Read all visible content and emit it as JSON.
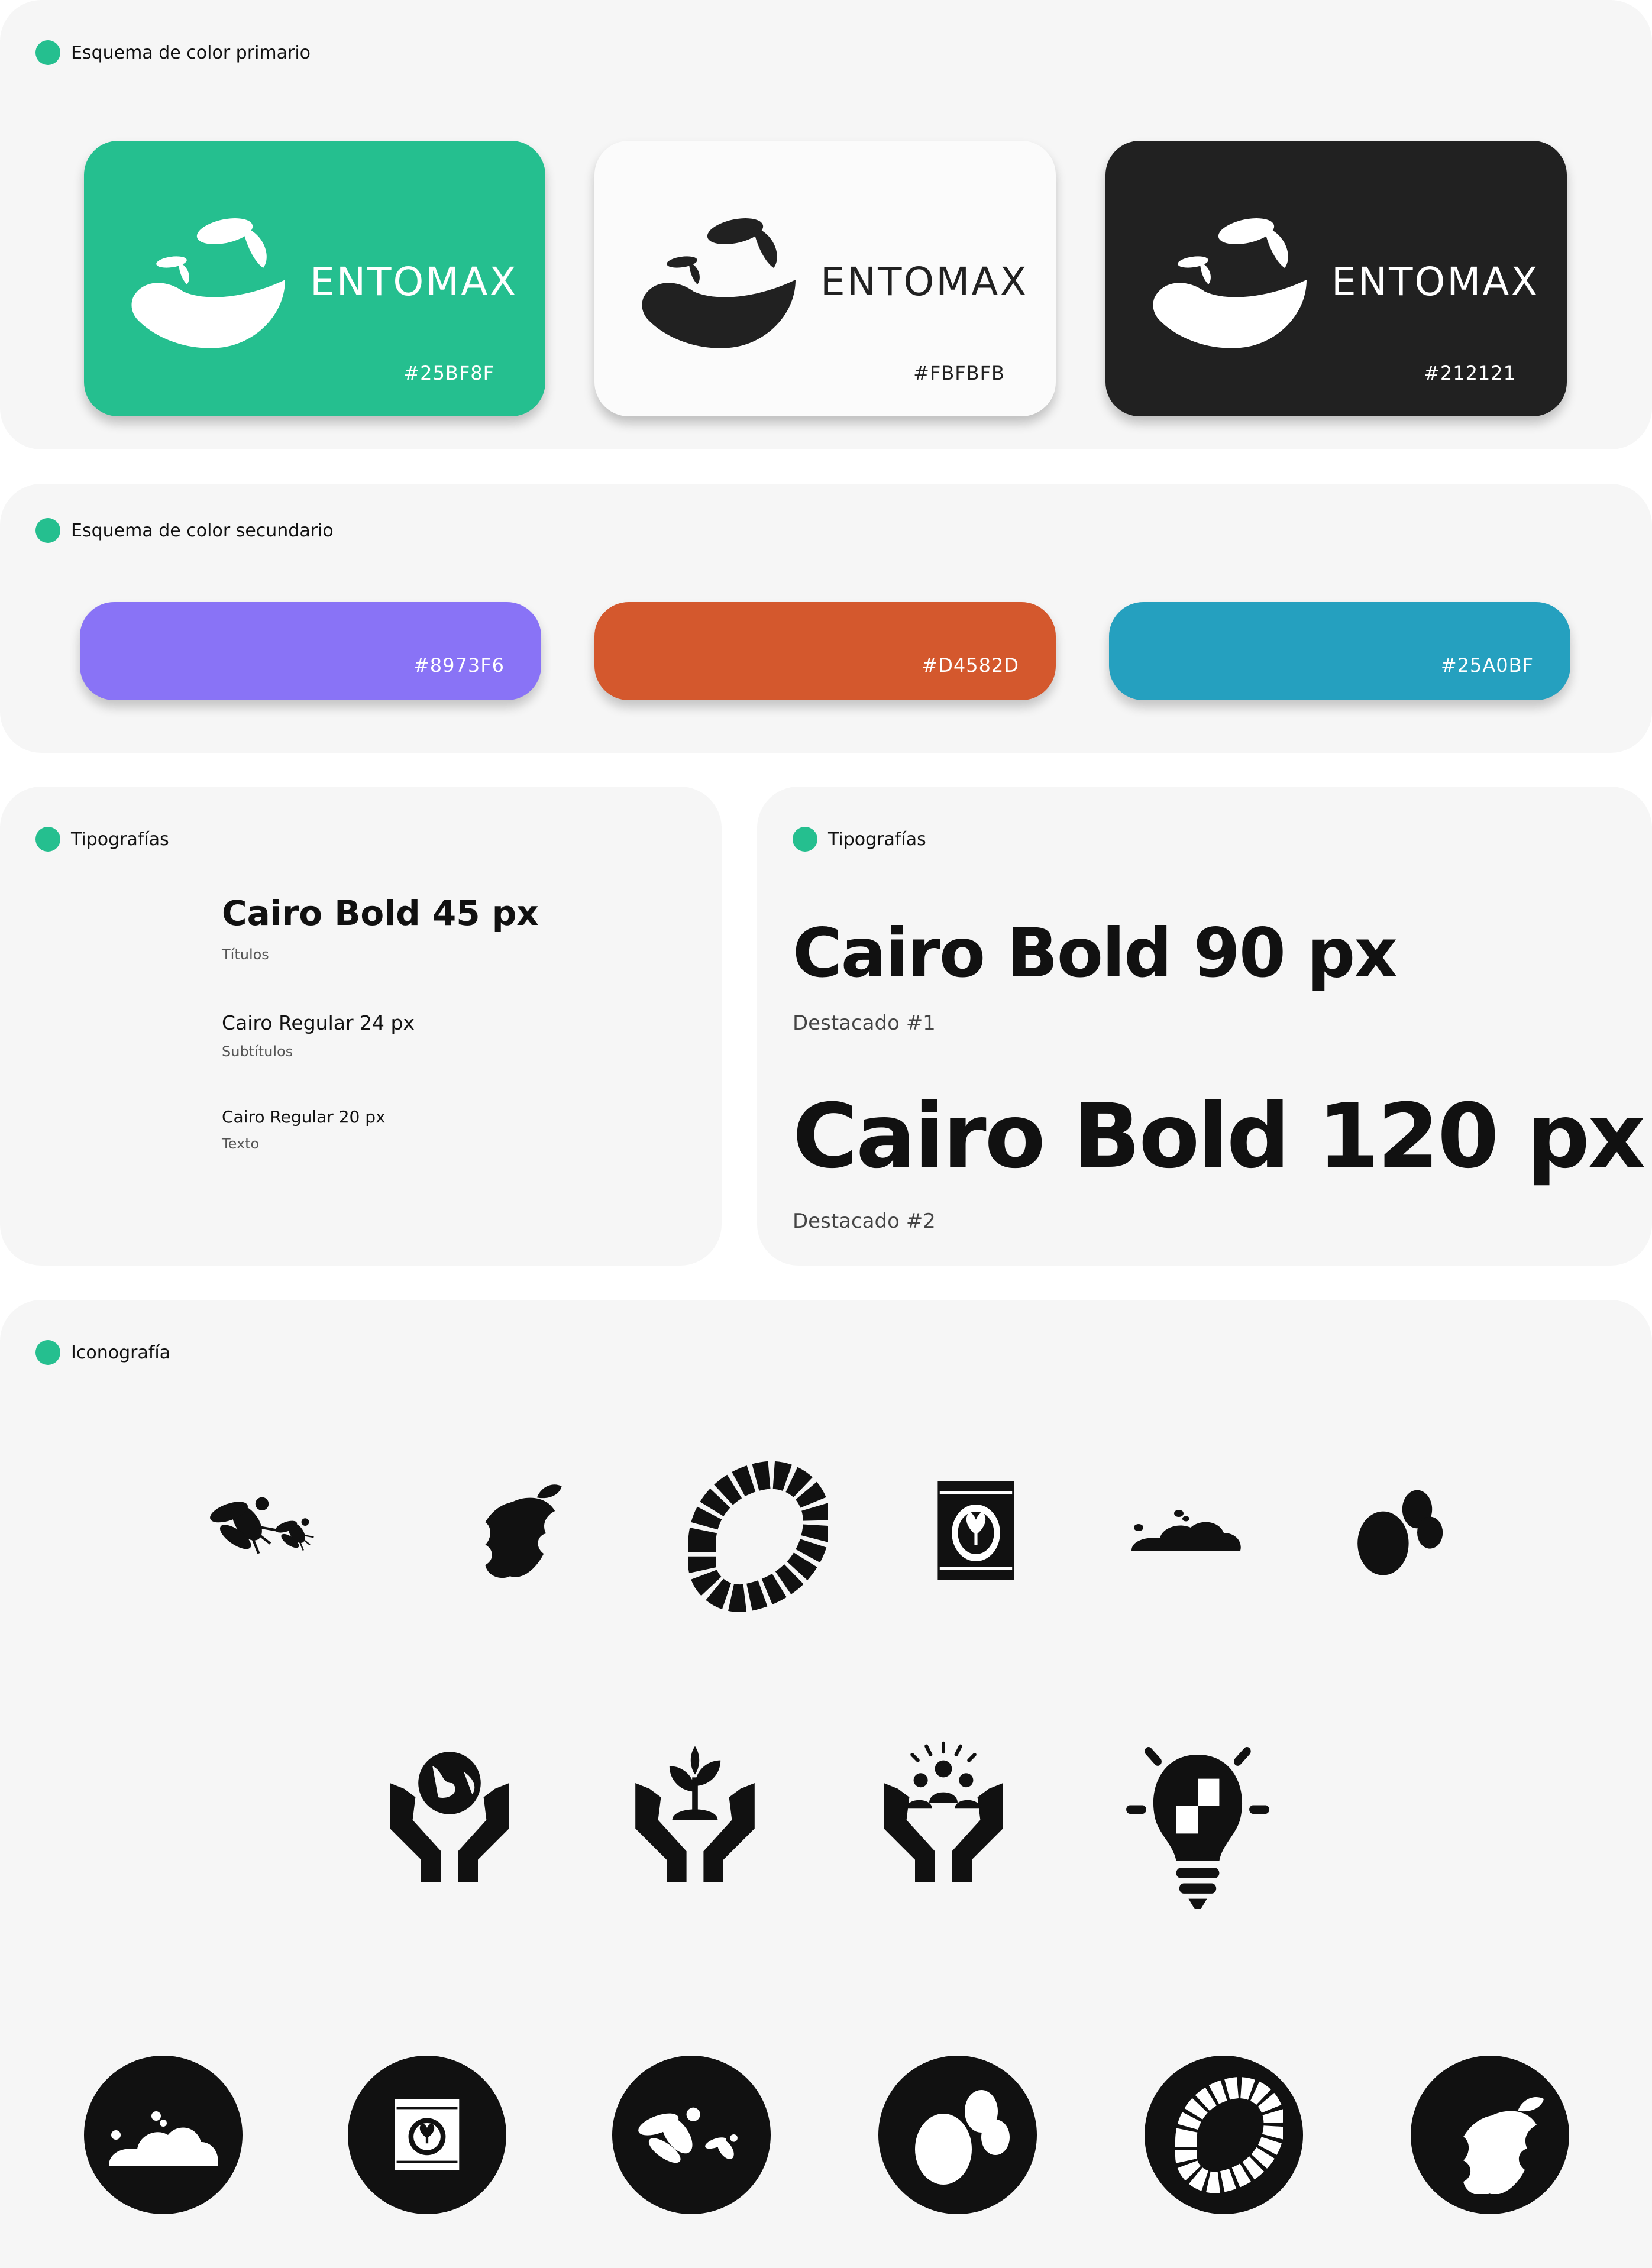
{
  "sections": {
    "primary": {
      "label": "Esquema de color primario"
    },
    "secondary": {
      "label": "Esquema de color secundario"
    },
    "typo_left": {
      "label": "Tipografías"
    },
    "typo_right": {
      "label": "Tipografías"
    },
    "icons": {
      "label": "Iconografía"
    }
  },
  "brand": {
    "name": "ENTOMAX"
  },
  "primary_colors": [
    {
      "hex": "#25BF8F",
      "label": "#25BF8F"
    },
    {
      "hex": "#FBFBFB",
      "label": "#FBFBFB"
    },
    {
      "hex": "#212121",
      "label": "#212121"
    }
  ],
  "secondary_colors": [
    {
      "hex": "#8973F6",
      "label": "#8973F6"
    },
    {
      "hex": "#D4582D",
      "label": "#D4582D"
    },
    {
      "hex": "#25A0BF",
      "label": "#25A0BF"
    }
  ],
  "typography_left": [
    {
      "sample": "Cairo Bold 45 px",
      "usage": "Títulos"
    },
    {
      "sample": "Cairo Regular 24 px",
      "usage": "Subtítulos"
    },
    {
      "sample": "Cairo Regular 20 px",
      "usage": "Texto"
    }
  ],
  "typography_right": [
    {
      "sample": "Cairo Bold 90 px",
      "usage": "Destacado #1"
    },
    {
      "sample": "Cairo Bold 120 px",
      "usage": "Destacado #2"
    }
  ],
  "icon_names": {
    "row1": [
      "flies-icon",
      "eaten-apple-icon",
      "larva-icon",
      "seed-bag-icon",
      "soil-icon",
      "eggs-icon"
    ],
    "row2": [
      "hands-globe-icon",
      "hands-plant-icon",
      "hands-community-icon",
      "lightbulb-puzzle-icon"
    ],
    "row3": [
      "soil-badge-icon",
      "seed-bag-badge-icon",
      "flies-badge-icon",
      "eggs-badge-icon",
      "larva-badge-icon",
      "eaten-apple-badge-icon"
    ]
  },
  "accent_color": "#25BF8F"
}
